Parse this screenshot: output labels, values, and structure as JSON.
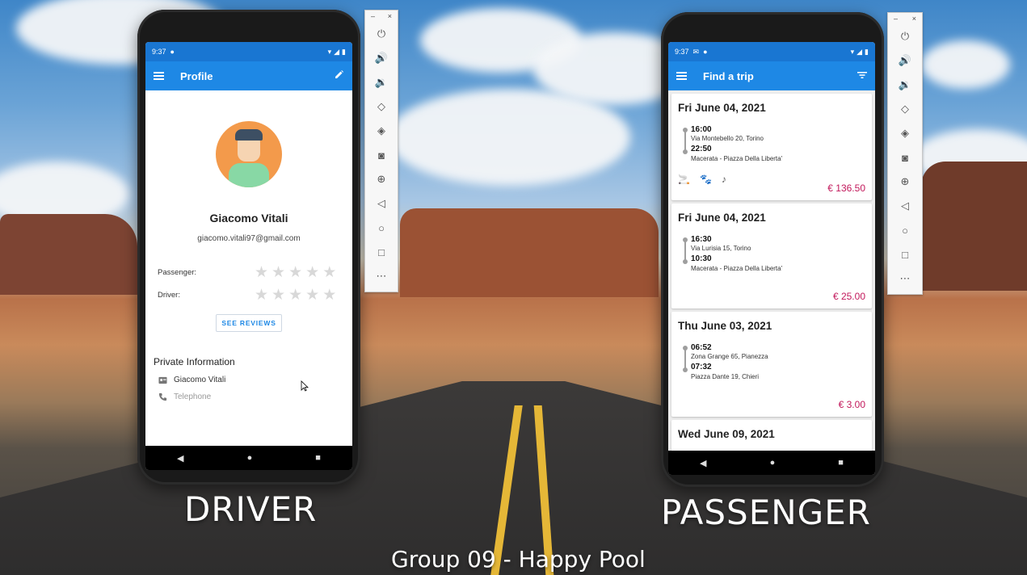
{
  "driver_phone": {
    "status_time": "9:37",
    "toolbar_title": "Profile",
    "name": "Giacomo Vitali",
    "email": "giacomo.vitali97@gmail.com",
    "ratings": [
      {
        "label": "Passenger:",
        "stars": 0
      },
      {
        "label": "Driver:",
        "stars": 0
      }
    ],
    "reviews_button": "SEE REVIEWS",
    "private_title": "Private Information",
    "private_name": "Giacomo Vitali",
    "telephone_placeholder": "Telephone",
    "icons": {
      "menu": "menu-icon",
      "edit": "pencil-icon",
      "person": "badge-icon",
      "phone": "phone-icon"
    }
  },
  "passenger_phone": {
    "status_time": "9:37",
    "toolbar_title": "Find a trip",
    "trips": [
      {
        "date": "Fri June 04, 2021",
        "dep_time": "16:00",
        "dep_place": "Via Montebello 20, Torino",
        "arr_time": "22:50",
        "arr_place": "Macerata - Piazza Della Liberta'",
        "price": "€ 136.50",
        "amenities": [
          "smoking-icon",
          "pets-icon",
          "no-music-icon"
        ]
      },
      {
        "date": "Fri June 04, 2021",
        "dep_time": "16:30",
        "dep_place": "Via Lurisia 15, Torino",
        "arr_time": "10:30",
        "arr_place": "Macerata - Piazza Della Liberta'",
        "price": "€ 25.00",
        "amenities": []
      },
      {
        "date": "Thu June 03, 2021",
        "dep_time": "06:52",
        "dep_place": "Zona Grange 65, Pianezza",
        "arr_time": "07:32",
        "arr_place": "Piazza Dante 19, Chieri",
        "price": "€ 3.00",
        "amenities": []
      },
      {
        "date": "Wed June 09, 2021",
        "dep_time": "",
        "dep_place": "",
        "arr_time": "",
        "arr_place": "",
        "price": "",
        "amenities": []
      }
    ]
  },
  "emulator_panel": {
    "buttons": [
      "power-icon",
      "volume-up-icon",
      "volume-down-icon",
      "rotate-left-icon",
      "rotate-right-icon",
      "camera-icon",
      "zoom-icon",
      "back-icon",
      "home-icon",
      "overview-icon",
      "more-icon"
    ]
  },
  "captions": {
    "driver": "DRIVER",
    "passenger": "PASSENGER",
    "footer": "Group 09 - Happy Pool"
  },
  "colors": {
    "toolbar": "#1e88e5",
    "statusbar": "#1976d2",
    "price": "#c2185b",
    "avatar_bg": "#f39a4b"
  }
}
